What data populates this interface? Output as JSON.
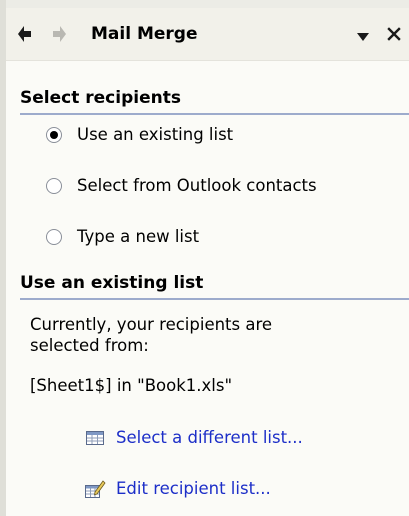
{
  "title_bar": {
    "title": "Mail Merge",
    "back_icon": "back-arrow-icon",
    "forward_icon": "forward-arrow-icon",
    "menu_icon": "dropdown-arrow-icon",
    "close_icon": "close-icon",
    "close_label": "x"
  },
  "select_recipients": {
    "heading": "Select recipients",
    "options": [
      {
        "label": "Use an existing list",
        "checked": true
      },
      {
        "label": "Select from Outlook contacts",
        "checked": false
      },
      {
        "label": "Type a new list",
        "checked": false
      }
    ]
  },
  "use_existing": {
    "heading": "Use an existing list",
    "description_line1": "Currently, your recipients are",
    "description_line2": "selected from:",
    "source": "[Sheet1$] in \"Book1.xls\"",
    "links": [
      {
        "label": "Select a different list...",
        "icon": "table-icon"
      },
      {
        "label": "Edit recipient list...",
        "icon": "edit-list-icon"
      }
    ]
  },
  "colors": {
    "link": "#1c2ec8",
    "section_rule": "#9dabcc",
    "title_bar_bg": "#f2f1ea",
    "panel_bg": "#fbfbf7"
  }
}
